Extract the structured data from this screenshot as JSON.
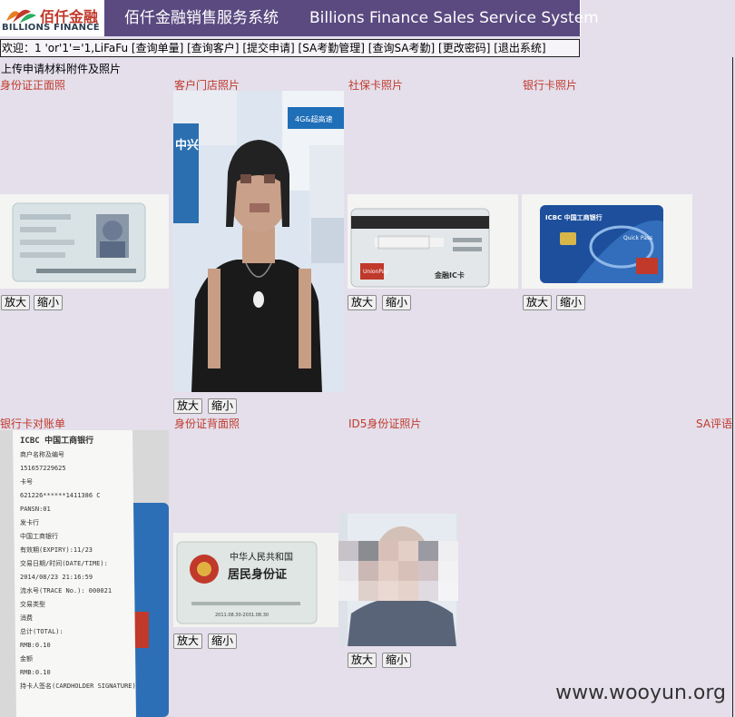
{
  "header": {
    "logo_cn": "佰仟金融",
    "logo_en": "BILLIONS FINANCE",
    "title_cn": "佰仟金融销售服务系统",
    "title_en": "Billions Finance Sales Service System"
  },
  "nav": {
    "welcome": "欢迎：1 'or'1'='1,LiFaFu",
    "links": [
      "[查询单量]",
      "[查询客户]",
      "[提交申请]",
      "[SA考勤管理]",
      "[查询SA考勤]",
      "[更改密码]",
      "[退出系统]"
    ]
  },
  "section_title": "上传申请材料附件及照片",
  "buttons": {
    "zoom_in": "放大",
    "zoom_out": "缩小"
  },
  "photos": [
    {
      "label": "身份证正面照"
    },
    {
      "label": "客户门店照片",
      "store_sign": "4G&超高速",
      "store_text": "中兴"
    },
    {
      "label": "社保卡照片",
      "card_text": "金融IC卡"
    },
    {
      "label": "银行卡照片",
      "bank": "ICBC 中国工商银行",
      "card_brand": "Quick Pass"
    },
    {
      "label": "银行卡对账单",
      "receipt_lines": [
        "ICBC 中国工商银行",
        "商户名称及编号",
        "151657229625",
        "卡号",
        "621226******1411386 C",
        "PANSN:01",
        "发卡行",
        "中国工商银行",
        "有效期(EXPIRY):11/23",
        "交易日期/时间(DATE/TIME):",
        "2014/08/23 21:16:59",
        "流水号(TRACE No.): 000021",
        "交易类型",
        "消费",
        "总计(TOTAL):",
        "RMB:0.10",
        "金额",
        "RMB:0.10",
        "持卡人签名(CARDHOLDER SIGNATURE)"
      ]
    },
    {
      "label": "身份证背面照",
      "id_title_1": "中华人民共和国",
      "id_title_2": "居民身份证",
      "id_validity": "2011.08.30-2031.08.30"
    },
    {
      "label": "ID5身份证照片"
    },
    {
      "label": "SA评语"
    }
  ],
  "watermark": "www.wooyun.org",
  "colors": {
    "title_bar": "#5a4a80",
    "label_red": "#c0392b",
    "background": "#e4dfeb"
  }
}
